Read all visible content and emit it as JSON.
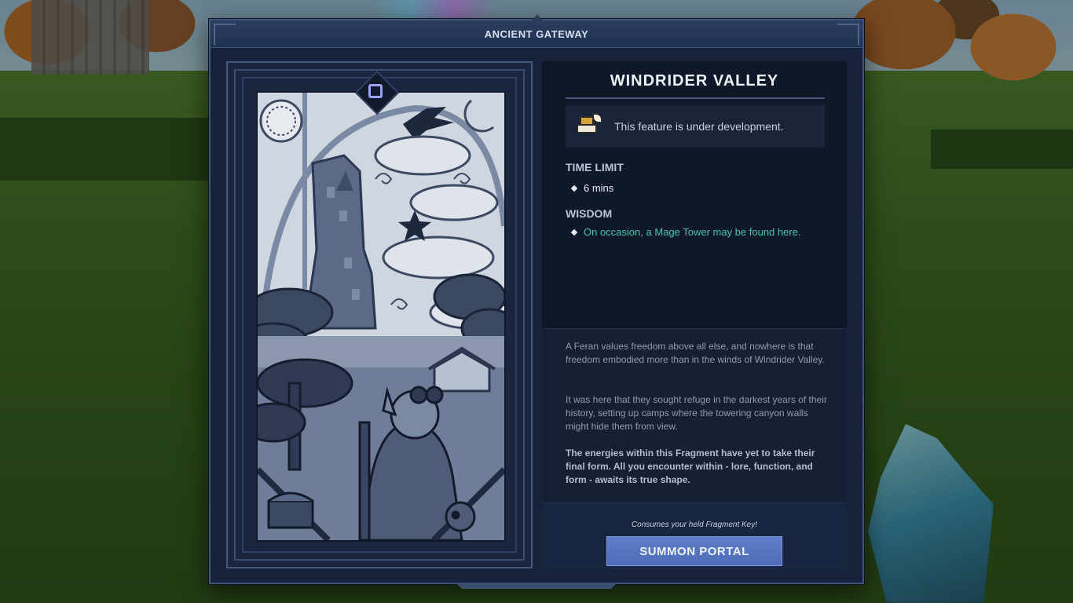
{
  "window": {
    "title": "ANCIENT GATEWAY"
  },
  "destination": {
    "name": "WINDRIDER VALLEY",
    "notice": "This feature is under development.",
    "notice_icon": "under-construction-icon"
  },
  "time_limit": {
    "label": "TIME LIMIT",
    "value": "6 mins"
  },
  "wisdom": {
    "label": "WISDOM",
    "value": "On occasion, a Mage Tower may be found here."
  },
  "description": {
    "p1": "A Feran values freedom above all else, and nowhere is that freedom embodied more than in the winds of Windrider Valley.",
    "p2": "It was here that they sought refuge in the darkest years of their history, setting up camps where the towering canyon walls might hide them from view.",
    "p3": "The energies within this Fragment have yet to take their final form. All you encounter within - lore, function, and form - awaits its true shape."
  },
  "summon": {
    "cost_note": "Consumes your held Fragment Key!",
    "button_label": "SUMMON PORTAL"
  },
  "colors": {
    "panel": "#17233a",
    "accent_button": "#5e7fc9",
    "wisdom_text": "#43c6a8"
  }
}
